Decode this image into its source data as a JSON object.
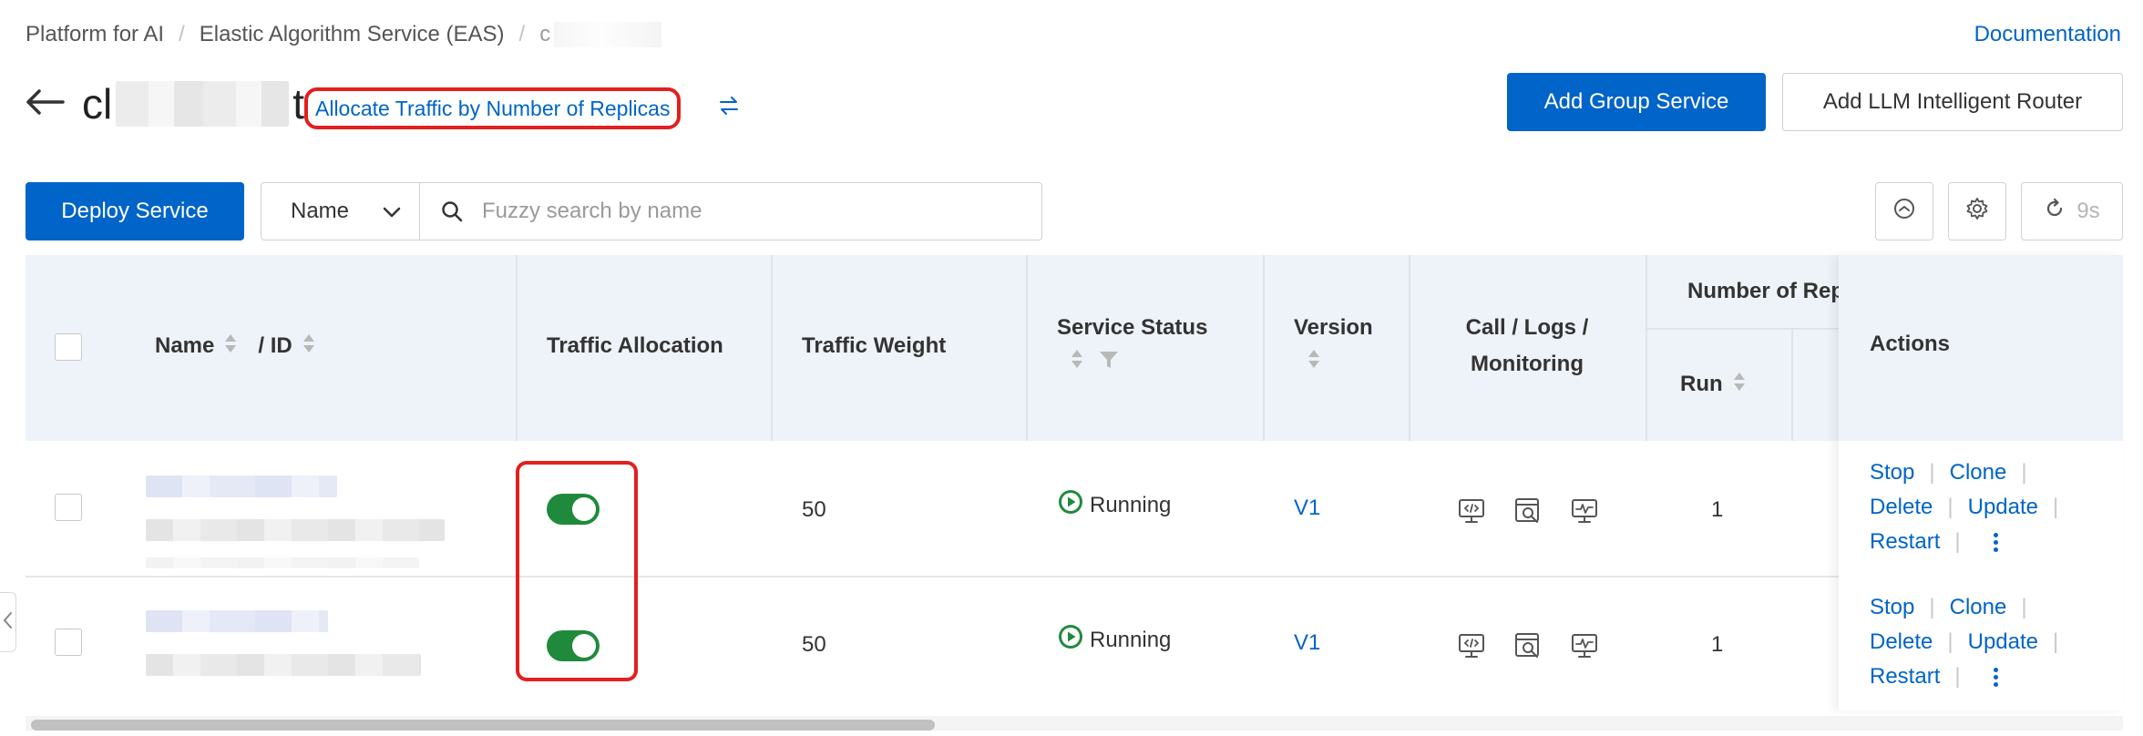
{
  "breadcrumb": {
    "items": [
      "Platform for AI",
      "Elastic Algorithm Service (EAS)",
      "c"
    ]
  },
  "header": {
    "documentation_label": "Documentation",
    "title_start": "cl",
    "title_end": "t",
    "traffic_link_label": "Allocate Traffic by Number of Replicas",
    "add_group_label": "Add Group Service",
    "add_llm_label": "Add LLM Intelligent Router"
  },
  "toolbar": {
    "deploy_label": "Deploy Service",
    "search_field_selected": "Name",
    "search_placeholder": "Fuzzy search by name",
    "refresh_countdown": "9s"
  },
  "table": {
    "columns": {
      "name": "Name",
      "id": "/ ID",
      "traffic_allocation": "Traffic Allocation",
      "traffic_weight": "Traffic Weight",
      "service_status": "Service Status",
      "version": "Version",
      "call_logs_line1": "Call / Logs /",
      "call_logs_line2": "Monitoring",
      "replicas_group": "Number of Rep",
      "run": "Run",
      "actions": "Actions"
    },
    "rows": [
      {
        "traffic_enabled": true,
        "weight": "50",
        "status": "Running",
        "version": "V1",
        "run": "1"
      },
      {
        "traffic_enabled": true,
        "weight": "50",
        "status": "Running",
        "version": "V1",
        "run": "1"
      }
    ],
    "actions": {
      "stop": "Stop",
      "clone": "Clone",
      "delete": "Delete",
      "update": "Update",
      "restart": "Restart"
    }
  },
  "colors": {
    "primary": "#0064c8",
    "running": "#1f8a3c",
    "highlight": "#e31f1f"
  }
}
